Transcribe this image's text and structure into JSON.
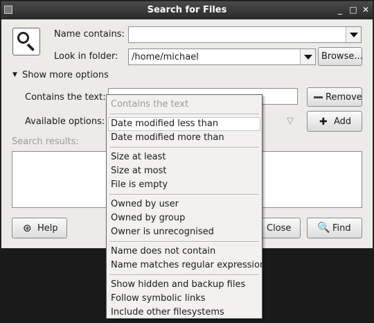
{
  "window": {
    "title": "Search for Files",
    "controls": {
      "minimize": "_",
      "maximize": "□",
      "close": "✕"
    }
  },
  "form": {
    "name_label": "Name contains:",
    "name_value": "",
    "folder_label": "Look in folder:",
    "folder_value": "/home/michael",
    "browse_button": "Browse...",
    "more_options_label": "Show more options",
    "contains_label": "Contains the text:",
    "contains_value": "",
    "remove_button": "Remove",
    "available_label": "Available options:",
    "add_button": "Add",
    "results_label": "Search results:"
  },
  "footer": {
    "help_button": "Help",
    "close_button": "Close",
    "find_button": "Find"
  },
  "options_menu": {
    "groups": [
      [
        {
          "label": "Contains the text",
          "disabled": true
        }
      ],
      [
        {
          "label": "Date modified less than",
          "highlighted": true
        },
        {
          "label": "Date modified more than"
        }
      ],
      [
        {
          "label": "Size at least"
        },
        {
          "label": "Size at most"
        },
        {
          "label": "File is empty"
        }
      ],
      [
        {
          "label": "Owned by user"
        },
        {
          "label": "Owned by group"
        },
        {
          "label": "Owner is unrecognised"
        }
      ],
      [
        {
          "label": "Name does not contain"
        },
        {
          "label": "Name matches regular expression"
        }
      ],
      [
        {
          "label": "Show hidden and backup files"
        },
        {
          "label": "Follow symbolic links"
        },
        {
          "label": "Include other filesystems"
        }
      ]
    ]
  }
}
